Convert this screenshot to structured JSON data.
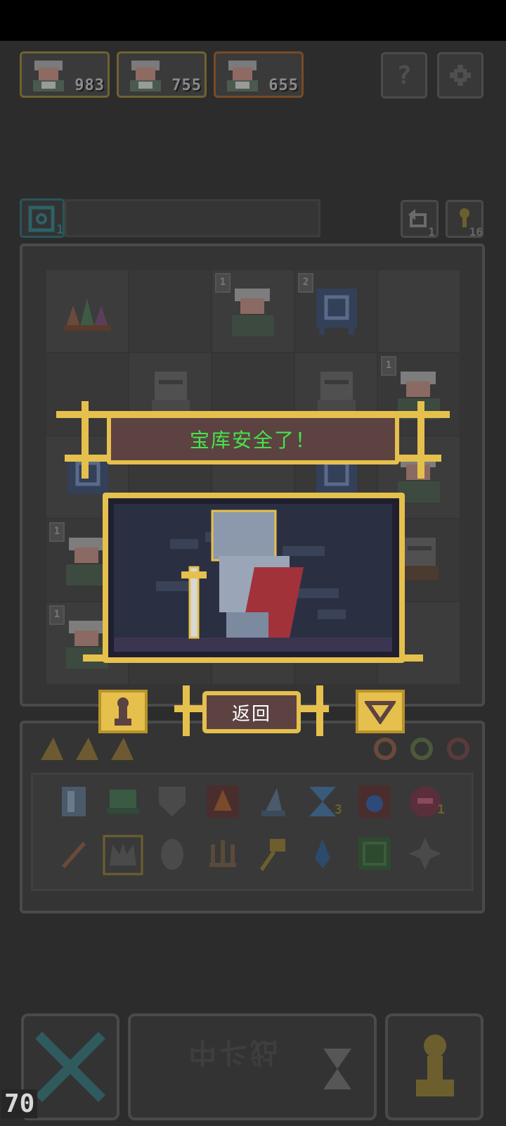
{
  "heroes": [
    {
      "value": "983",
      "border": "#6e6230"
    },
    {
      "value": "755",
      "border": "#6e6230"
    },
    {
      "value": "655",
      "border": "#7a4a26"
    }
  ],
  "top_buttons": {
    "help_glyph": "?",
    "settings_icon": "gear-icon"
  },
  "board_bar": {
    "key_count": "1",
    "undo_count": "1",
    "coin_count": "16"
  },
  "board": {
    "badges": [
      "1",
      "2",
      "1",
      "1",
      "1"
    ]
  },
  "dialog": {
    "title": "宝库安全了！",
    "return_label": "返回",
    "title_color": "#43e64b",
    "gold": "#e6c04d",
    "panel": "#5d4242"
  },
  "inventory": {
    "row1": [
      {
        "icon": "crystal-icon"
      },
      {
        "icon": "helmet-icon"
      },
      {
        "icon": "shield-icon"
      },
      {
        "icon": "fire-icon"
      },
      {
        "icon": "wizard-hat-icon"
      },
      {
        "icon": "hourglass-icon",
        "count": "3"
      },
      {
        "icon": "water-drop-icon"
      },
      {
        "icon": "demon-icon",
        "count": "1"
      }
    ],
    "row2": [
      {
        "icon": "dagger-icon"
      },
      {
        "icon": "crown-icon"
      },
      {
        "icon": "egg-icon"
      },
      {
        "icon": "candelabra-icon"
      },
      {
        "icon": "key-staff-icon"
      },
      {
        "icon": "potion-drop-icon"
      },
      {
        "icon": "map-icon"
      },
      {
        "icon": "shuriken-icon"
      }
    ]
  },
  "bottom": {
    "battle_label": "战斗中",
    "level": "70"
  }
}
